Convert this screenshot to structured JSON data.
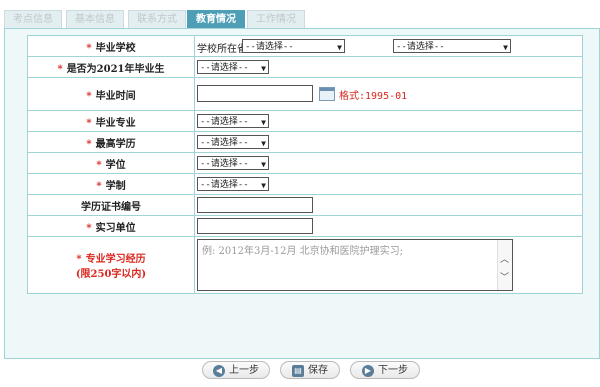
{
  "tabs": [
    "考点信息",
    "基本信息",
    "联系方式",
    "教育情况",
    "工作情况"
  ],
  "active_tab": "教育情况",
  "form": {
    "school": {
      "label": "毕业学校",
      "province_prefix": "学校所在省",
      "select1": "--请选择--",
      "select2": "--请选择--"
    },
    "grad2021": {
      "label": "是否为2021年毕业生",
      "select": "--请选择--"
    },
    "grad_time": {
      "label": "毕业时间",
      "value": "",
      "format_hint": "格式:1995-01"
    },
    "major": {
      "label": "毕业专业",
      "select": "--请选择--"
    },
    "education": {
      "label": "最高学历",
      "select": "--请选择--"
    },
    "degree": {
      "label": "学位",
      "select": "--请选择--"
    },
    "schooling": {
      "label": "学制",
      "select": "--请选择--"
    },
    "cert_no": {
      "label": "学历证书编号",
      "value": ""
    },
    "internship": {
      "label": "实习单位",
      "value": ""
    },
    "experience": {
      "label": "专业学习经历",
      "limit": "(限250字以内)",
      "placeholder": "例: 2012年3月-12月 北京协和医院护理实习;"
    }
  },
  "buttons": {
    "prev": "上一步",
    "save": "保存",
    "next": "下一步"
  },
  "colors": {
    "accent": "#4e9fb6",
    "required": "#d9281f",
    "border": "#9fd3d6"
  },
  "icons": {
    "calendar": "calendar-icon",
    "prev": "arrow-left-icon",
    "save": "save-icon",
    "next": "arrow-right-icon"
  }
}
